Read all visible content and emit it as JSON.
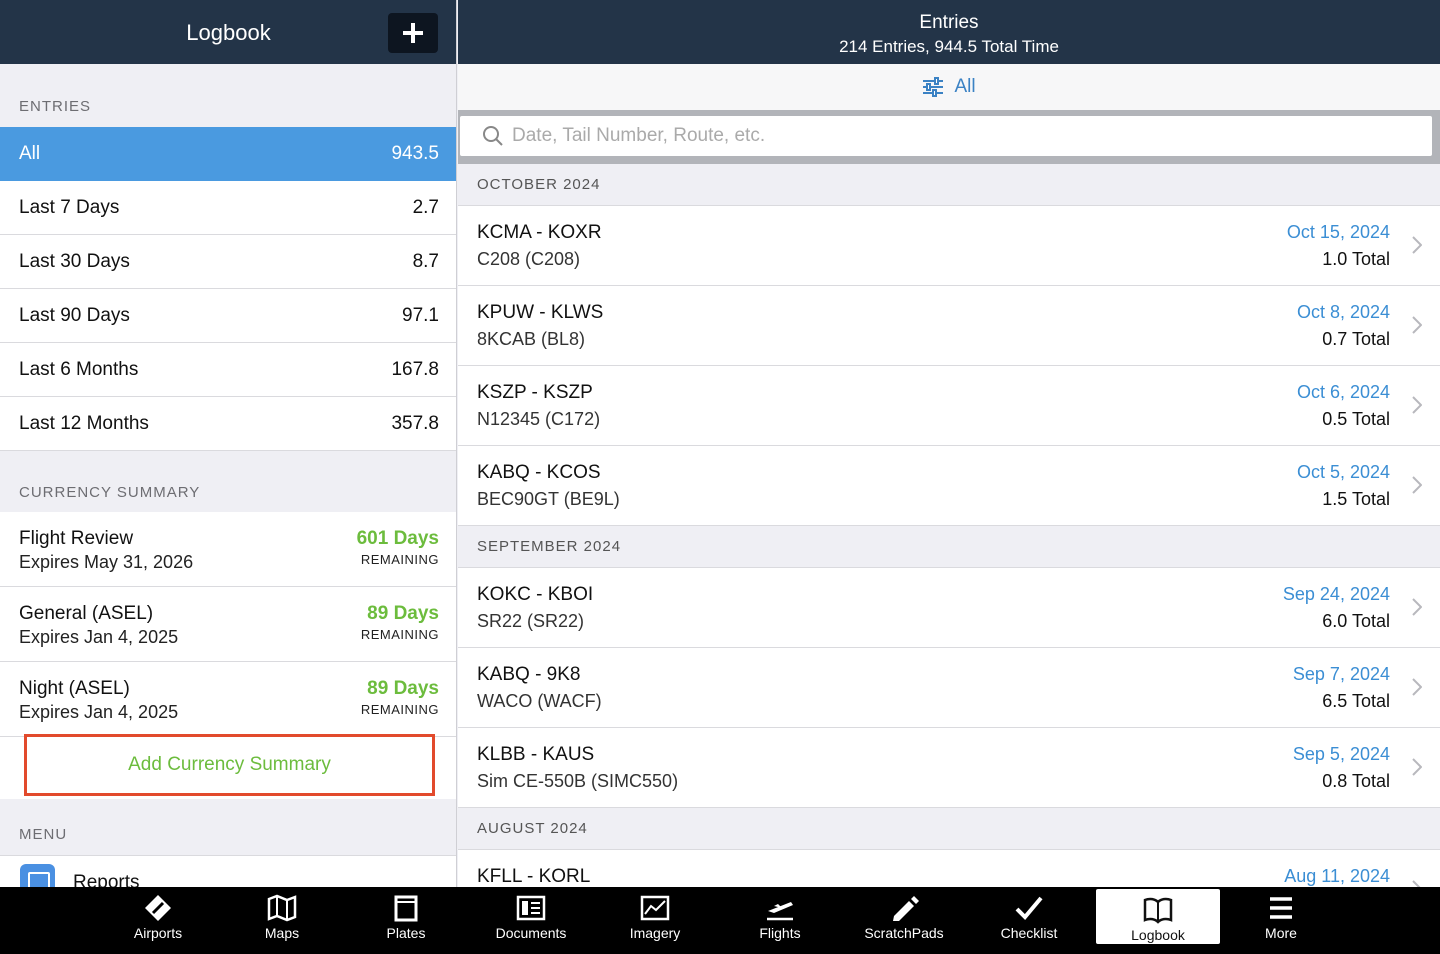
{
  "sidebar": {
    "title": "Logbook",
    "entries_label": "ENTRIES",
    "entries": [
      {
        "label": "All",
        "value": "943.5"
      },
      {
        "label": "Last 7 Days",
        "value": "2.7"
      },
      {
        "label": "Last 30 Days",
        "value": "8.7"
      },
      {
        "label": "Last 90 Days",
        "value": "97.1"
      },
      {
        "label": "Last 6 Months",
        "value": "167.8"
      },
      {
        "label": "Last 12 Months",
        "value": "357.8"
      }
    ],
    "currency_label": "CURRENCY SUMMARY",
    "currency": [
      {
        "name": "Flight Review",
        "expires": "Expires May 31, 2026",
        "days": "601 Days",
        "remaining": "REMAINING"
      },
      {
        "name": "General (ASEL)",
        "expires": "Expires Jan 4, 2025",
        "days": "89 Days",
        "remaining": "REMAINING"
      },
      {
        "name": "Night (ASEL)",
        "expires": "Expires Jan 4, 2025",
        "days": "89 Days",
        "remaining": "REMAINING"
      }
    ],
    "add_currency": "Add Currency Summary",
    "menu_label": "MENU",
    "menu_item": "Reports"
  },
  "main": {
    "title": "Entries",
    "subtitle": "214 Entries, 944.5 Total Time",
    "filter_label": "All",
    "search_placeholder": "Date, Tail Number, Route, etc.",
    "months": [
      {
        "label": "OCTOBER 2024",
        "entries": [
          {
            "route": "KCMA - KOXR",
            "aircraft": "C208 (C208)",
            "date": "Oct 15, 2024",
            "total_value": "1.0",
            "total_label": "Total"
          },
          {
            "route": "KPUW - KLWS",
            "aircraft": "8KCAB (BL8)",
            "date": "Oct 8, 2024",
            "total_value": "0.7",
            "total_label": "Total"
          },
          {
            "route": "KSZP - KSZP",
            "aircraft": "N12345 (C172)",
            "date": "Oct 6, 2024",
            "total_value": "0.5",
            "total_label": "Total"
          },
          {
            "route": "KABQ - KCOS",
            "aircraft": "BEC90GT (BE9L)",
            "date": "Oct 5, 2024",
            "total_value": "1.5",
            "total_label": "Total"
          }
        ]
      },
      {
        "label": "SEPTEMBER 2024",
        "entries": [
          {
            "route": "KOKC - KBOI",
            "aircraft": "SR22 (SR22)",
            "date": "Sep 24, 2024",
            "total_value": "6.0",
            "total_label": "Total"
          },
          {
            "route": "KABQ - 9K8",
            "aircraft": "WACO (WACF)",
            "date": "Sep 7, 2024",
            "total_value": "6.5",
            "total_label": "Total"
          },
          {
            "route": "KLBB - KAUS",
            "aircraft": "Sim CE-550B (SIMC550)",
            "date": "Sep 5, 2024",
            "total_value": "0.8",
            "total_label": "Total"
          }
        ]
      },
      {
        "label": "AUGUST 2024",
        "entries": [
          {
            "route": "KFLL - KORL",
            "aircraft": "",
            "date": "Aug 11, 2024",
            "total_value": "",
            "total_label": ""
          }
        ]
      }
    ]
  },
  "tabs": [
    {
      "label": "Airports",
      "icon": "airports-icon"
    },
    {
      "label": "Maps",
      "icon": "maps-icon"
    },
    {
      "label": "Plates",
      "icon": "plates-icon"
    },
    {
      "label": "Documents",
      "icon": "documents-icon"
    },
    {
      "label": "Imagery",
      "icon": "imagery-icon"
    },
    {
      "label": "Flights",
      "icon": "flights-icon"
    },
    {
      "label": "ScratchPads",
      "icon": "scratchpads-icon"
    },
    {
      "label": "Checklist",
      "icon": "checklist-icon"
    },
    {
      "label": "Logbook",
      "icon": "logbook-icon",
      "selected": true
    },
    {
      "label": "More",
      "icon": "more-icon"
    }
  ],
  "colors": {
    "header": "#233448",
    "accent": "#4a9ae0",
    "green": "#6cbc3d",
    "highlight": "#e24a2c"
  }
}
